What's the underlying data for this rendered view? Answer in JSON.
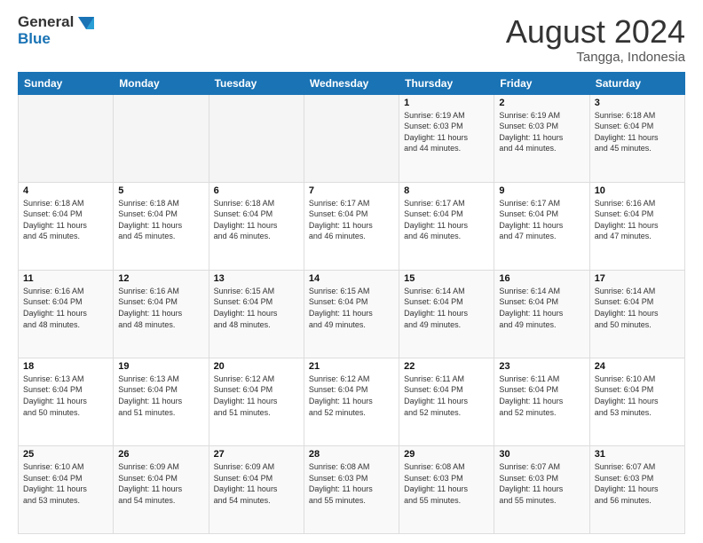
{
  "header": {
    "logo_line1": "General",
    "logo_line2": "Blue",
    "month": "August 2024",
    "location": "Tangga, Indonesia"
  },
  "weekdays": [
    "Sunday",
    "Monday",
    "Tuesday",
    "Wednesday",
    "Thursday",
    "Friday",
    "Saturday"
  ],
  "weeks": [
    [
      {
        "day": "",
        "info": ""
      },
      {
        "day": "",
        "info": ""
      },
      {
        "day": "",
        "info": ""
      },
      {
        "day": "",
        "info": ""
      },
      {
        "day": "1",
        "info": "Sunrise: 6:19 AM\nSunset: 6:03 PM\nDaylight: 11 hours\nand 44 minutes."
      },
      {
        "day": "2",
        "info": "Sunrise: 6:19 AM\nSunset: 6:03 PM\nDaylight: 11 hours\nand 44 minutes."
      },
      {
        "day": "3",
        "info": "Sunrise: 6:18 AM\nSunset: 6:04 PM\nDaylight: 11 hours\nand 45 minutes."
      }
    ],
    [
      {
        "day": "4",
        "info": "Sunrise: 6:18 AM\nSunset: 6:04 PM\nDaylight: 11 hours\nand 45 minutes."
      },
      {
        "day": "5",
        "info": "Sunrise: 6:18 AM\nSunset: 6:04 PM\nDaylight: 11 hours\nand 45 minutes."
      },
      {
        "day": "6",
        "info": "Sunrise: 6:18 AM\nSunset: 6:04 PM\nDaylight: 11 hours\nand 46 minutes."
      },
      {
        "day": "7",
        "info": "Sunrise: 6:17 AM\nSunset: 6:04 PM\nDaylight: 11 hours\nand 46 minutes."
      },
      {
        "day": "8",
        "info": "Sunrise: 6:17 AM\nSunset: 6:04 PM\nDaylight: 11 hours\nand 46 minutes."
      },
      {
        "day": "9",
        "info": "Sunrise: 6:17 AM\nSunset: 6:04 PM\nDaylight: 11 hours\nand 47 minutes."
      },
      {
        "day": "10",
        "info": "Sunrise: 6:16 AM\nSunset: 6:04 PM\nDaylight: 11 hours\nand 47 minutes."
      }
    ],
    [
      {
        "day": "11",
        "info": "Sunrise: 6:16 AM\nSunset: 6:04 PM\nDaylight: 11 hours\nand 48 minutes."
      },
      {
        "day": "12",
        "info": "Sunrise: 6:16 AM\nSunset: 6:04 PM\nDaylight: 11 hours\nand 48 minutes."
      },
      {
        "day": "13",
        "info": "Sunrise: 6:15 AM\nSunset: 6:04 PM\nDaylight: 11 hours\nand 48 minutes."
      },
      {
        "day": "14",
        "info": "Sunrise: 6:15 AM\nSunset: 6:04 PM\nDaylight: 11 hours\nand 49 minutes."
      },
      {
        "day": "15",
        "info": "Sunrise: 6:14 AM\nSunset: 6:04 PM\nDaylight: 11 hours\nand 49 minutes."
      },
      {
        "day": "16",
        "info": "Sunrise: 6:14 AM\nSunset: 6:04 PM\nDaylight: 11 hours\nand 49 minutes."
      },
      {
        "day": "17",
        "info": "Sunrise: 6:14 AM\nSunset: 6:04 PM\nDaylight: 11 hours\nand 50 minutes."
      }
    ],
    [
      {
        "day": "18",
        "info": "Sunrise: 6:13 AM\nSunset: 6:04 PM\nDaylight: 11 hours\nand 50 minutes."
      },
      {
        "day": "19",
        "info": "Sunrise: 6:13 AM\nSunset: 6:04 PM\nDaylight: 11 hours\nand 51 minutes."
      },
      {
        "day": "20",
        "info": "Sunrise: 6:12 AM\nSunset: 6:04 PM\nDaylight: 11 hours\nand 51 minutes."
      },
      {
        "day": "21",
        "info": "Sunrise: 6:12 AM\nSunset: 6:04 PM\nDaylight: 11 hours\nand 52 minutes."
      },
      {
        "day": "22",
        "info": "Sunrise: 6:11 AM\nSunset: 6:04 PM\nDaylight: 11 hours\nand 52 minutes."
      },
      {
        "day": "23",
        "info": "Sunrise: 6:11 AM\nSunset: 6:04 PM\nDaylight: 11 hours\nand 52 minutes."
      },
      {
        "day": "24",
        "info": "Sunrise: 6:10 AM\nSunset: 6:04 PM\nDaylight: 11 hours\nand 53 minutes."
      }
    ],
    [
      {
        "day": "25",
        "info": "Sunrise: 6:10 AM\nSunset: 6:04 PM\nDaylight: 11 hours\nand 53 minutes."
      },
      {
        "day": "26",
        "info": "Sunrise: 6:09 AM\nSunset: 6:04 PM\nDaylight: 11 hours\nand 54 minutes."
      },
      {
        "day": "27",
        "info": "Sunrise: 6:09 AM\nSunset: 6:04 PM\nDaylight: 11 hours\nand 54 minutes."
      },
      {
        "day": "28",
        "info": "Sunrise: 6:08 AM\nSunset: 6:03 PM\nDaylight: 11 hours\nand 55 minutes."
      },
      {
        "day": "29",
        "info": "Sunrise: 6:08 AM\nSunset: 6:03 PM\nDaylight: 11 hours\nand 55 minutes."
      },
      {
        "day": "30",
        "info": "Sunrise: 6:07 AM\nSunset: 6:03 PM\nDaylight: 11 hours\nand 55 minutes."
      },
      {
        "day": "31",
        "info": "Sunrise: 6:07 AM\nSunset: 6:03 PM\nDaylight: 11 hours\nand 56 minutes."
      }
    ]
  ]
}
